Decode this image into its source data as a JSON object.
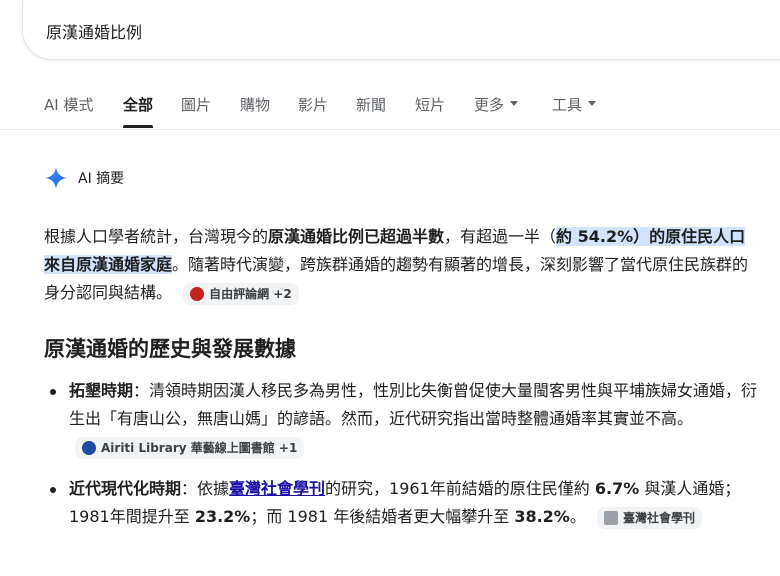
{
  "search": {
    "query": "原漢通婚比例"
  },
  "tabs": [
    {
      "label": "AI 模式"
    },
    {
      "label": "全部"
    },
    {
      "label": "圖片"
    },
    {
      "label": "購物"
    },
    {
      "label": "影片"
    },
    {
      "label": "新聞"
    },
    {
      "label": "短片"
    },
    {
      "label": "更多"
    },
    {
      "label": "工具"
    }
  ],
  "ai": {
    "label": "AI 摘要"
  },
  "summary": {
    "p1": "根據人口學者統計，台灣現今的",
    "b1": "原漢通婚比例已超過半數",
    "p2": "，有超過一半（",
    "hl1": "約 54.2%）的原住民人口來自原漢通婚家庭",
    "p3": "。隨著時代演變，跨族群通婚的趨勢有顯著的增長，深刻影響了當代原住民族群的身分認同與結構。",
    "source": "自由評論網 +2"
  },
  "section_title": "原漢通婚的歷史與發展數據",
  "bullets": [
    {
      "title": "拓墾時期",
      "text": "：清領時期因漢人移民多為男性，性別比失衡曾促使大量閩客男性與平埔族婦女通婚，衍生出「有唐山公，無唐山媽」的諺語。然而，近代研究指出當時整體通婚率其實並不高。",
      "source": "Airiti Library 華藝線上圖書館 +1"
    },
    {
      "title": "近代現代化時期",
      "t1": "：依據",
      "link": "臺灣社會學刊",
      "t2": "的研究，1961年前結婚的原住民僅約 ",
      "v1": "6.7%",
      "t3": " 與漢人通婚；1981年間提升至 ",
      "v2": "23.2%",
      "t4": "；而 1981 年後結婚者更大幅攀升至 ",
      "v3": "38.2%",
      "t5": "。",
      "source": "臺灣社會學刊"
    }
  ],
  "colors": {
    "accent": "#1a73e8",
    "highlight": "#d3e3fd",
    "link": "#1a0dab"
  }
}
